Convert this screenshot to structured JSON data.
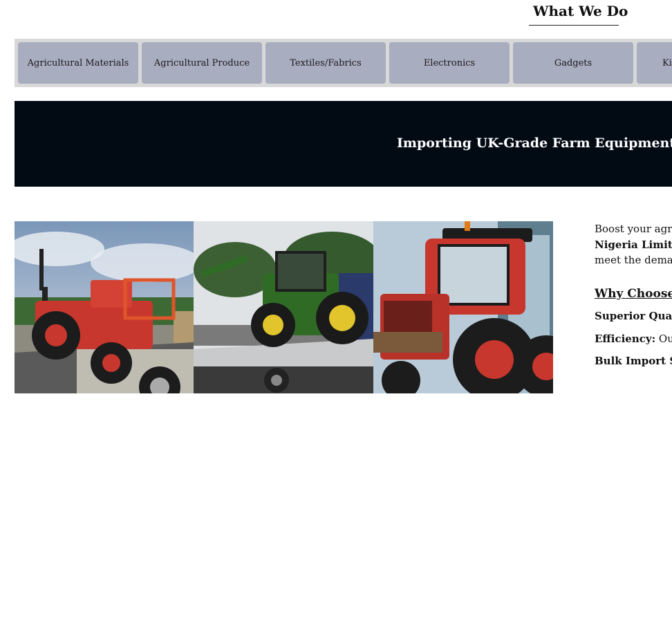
{
  "section_title": "What We Do",
  "tabs": [
    {
      "label": "Agricultural Materials"
    },
    {
      "label": "Agricultural Produce"
    },
    {
      "label": "Textiles/Fabrics"
    },
    {
      "label": "Electronics"
    },
    {
      "label": "Gadgets"
    },
    {
      "label": "Ki"
    }
  ],
  "banner": {
    "title": "Importing UK-Grade Farm Equipment and"
  },
  "intro": {
    "line1": "Boost your agri",
    "line2_bold": "Nigeria Limited",
    "line3": "meet the demar"
  },
  "why_heading": "Why Choose (",
  "points": [
    {
      "label": "Superior Quali",
      "text": ""
    },
    {
      "label": "Efficiency:",
      "text": " Our"
    },
    {
      "label": "Bulk Import Sa",
      "text": ""
    }
  ],
  "colors": {
    "tab_bg": "#a9adc0",
    "tabs_bar_bg": "#d8d8d8",
    "banner_bg": "#020a14",
    "tractor_red": "#c8372d",
    "tractor_green": "#2f6b25",
    "wheel_yellow": "#e2c52c"
  },
  "images": [
    {
      "icon": "red-compact-tractor-on-trailer-photo"
    },
    {
      "icon": "green-tractor-on-flatbed-photo"
    },
    {
      "icon": "red-tractor-closeup-photo"
    }
  ]
}
